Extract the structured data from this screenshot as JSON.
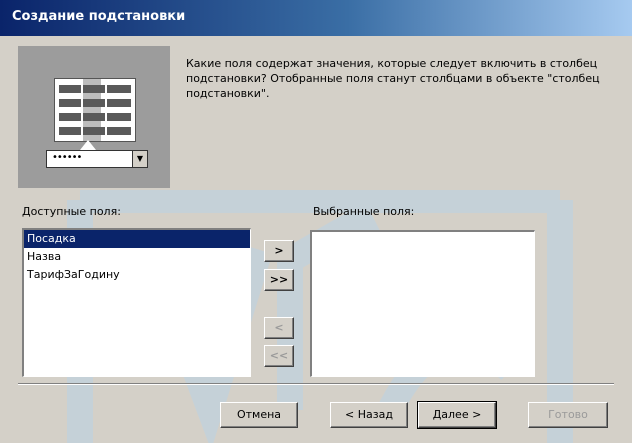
{
  "window": {
    "title": "Создание подстановки"
  },
  "description": "Какие поля содержат значения, которые следует включить в столбец подстановки? Отобранные поля станут столбцами в объекте \"столбец подстановки\".",
  "illustration": {
    "combo_text": "••••••"
  },
  "available": {
    "label": "Доступные поля:",
    "items": [
      "Посадка",
      "Назва",
      "ТарифЗаГодину"
    ],
    "selected_index": 0
  },
  "selected_fields": {
    "label": "Выбранные поля:",
    "items": []
  },
  "move_buttons": {
    "add_one": ">",
    "add_all": ">>",
    "remove_one": "<",
    "remove_all": "<<"
  },
  "footer": {
    "cancel": "Отмена",
    "back": "< Назад",
    "next": "Далее >",
    "finish": "Готово"
  }
}
